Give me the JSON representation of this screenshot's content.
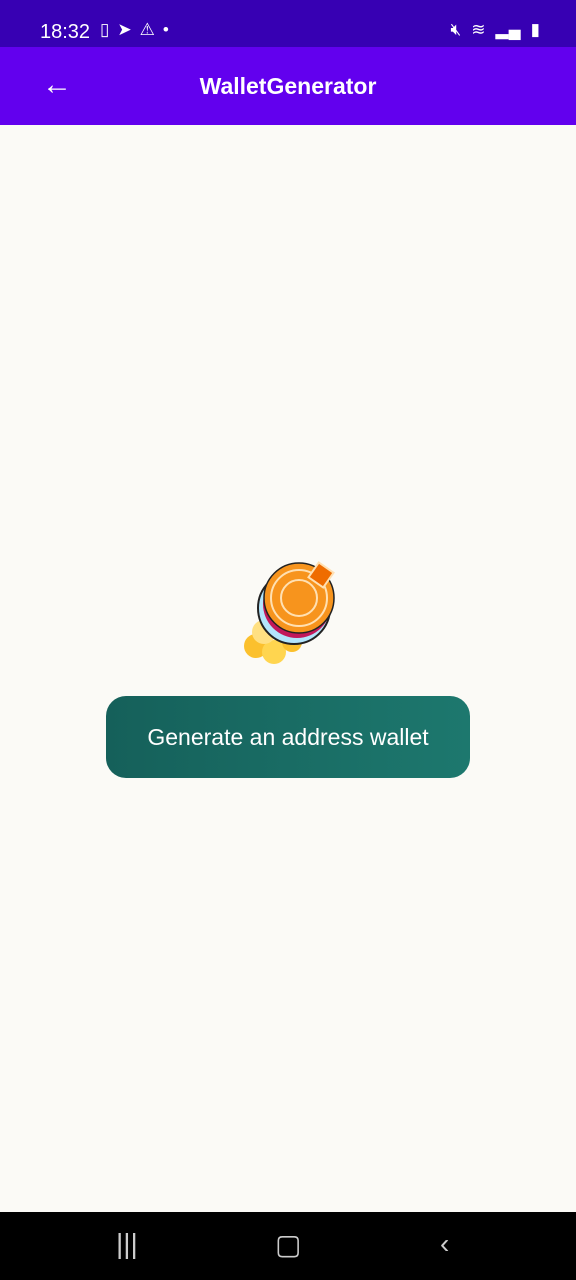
{
  "status_bar": {
    "time": "18:32"
  },
  "app_bar": {
    "title": "WalletGenerator"
  },
  "main": {
    "generate_button": "Generate an address wallet"
  }
}
